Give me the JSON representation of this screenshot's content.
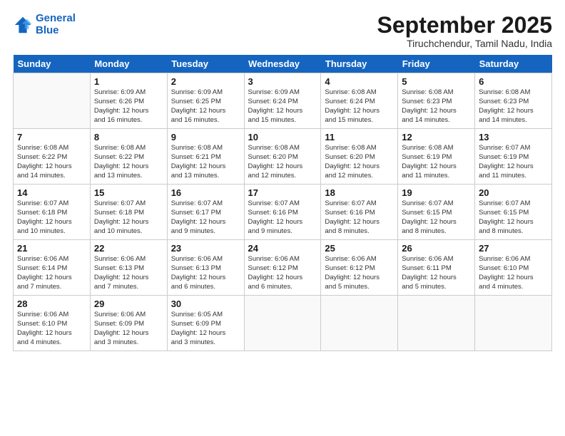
{
  "logo": {
    "line1": "General",
    "line2": "Blue"
  },
  "title": "September 2025",
  "location": "Tiruchchendur, Tamil Nadu, India",
  "days_of_week": [
    "Sunday",
    "Monday",
    "Tuesday",
    "Wednesday",
    "Thursday",
    "Friday",
    "Saturday"
  ],
  "weeks": [
    [
      {
        "num": "",
        "info": ""
      },
      {
        "num": "1",
        "info": "Sunrise: 6:09 AM\nSunset: 6:26 PM\nDaylight: 12 hours\nand 16 minutes."
      },
      {
        "num": "2",
        "info": "Sunrise: 6:09 AM\nSunset: 6:25 PM\nDaylight: 12 hours\nand 16 minutes."
      },
      {
        "num": "3",
        "info": "Sunrise: 6:09 AM\nSunset: 6:24 PM\nDaylight: 12 hours\nand 15 minutes."
      },
      {
        "num": "4",
        "info": "Sunrise: 6:08 AM\nSunset: 6:24 PM\nDaylight: 12 hours\nand 15 minutes."
      },
      {
        "num": "5",
        "info": "Sunrise: 6:08 AM\nSunset: 6:23 PM\nDaylight: 12 hours\nand 14 minutes."
      },
      {
        "num": "6",
        "info": "Sunrise: 6:08 AM\nSunset: 6:23 PM\nDaylight: 12 hours\nand 14 minutes."
      }
    ],
    [
      {
        "num": "7",
        "info": "Sunrise: 6:08 AM\nSunset: 6:22 PM\nDaylight: 12 hours\nand 14 minutes."
      },
      {
        "num": "8",
        "info": "Sunrise: 6:08 AM\nSunset: 6:22 PM\nDaylight: 12 hours\nand 13 minutes."
      },
      {
        "num": "9",
        "info": "Sunrise: 6:08 AM\nSunset: 6:21 PM\nDaylight: 12 hours\nand 13 minutes."
      },
      {
        "num": "10",
        "info": "Sunrise: 6:08 AM\nSunset: 6:20 PM\nDaylight: 12 hours\nand 12 minutes."
      },
      {
        "num": "11",
        "info": "Sunrise: 6:08 AM\nSunset: 6:20 PM\nDaylight: 12 hours\nand 12 minutes."
      },
      {
        "num": "12",
        "info": "Sunrise: 6:08 AM\nSunset: 6:19 PM\nDaylight: 12 hours\nand 11 minutes."
      },
      {
        "num": "13",
        "info": "Sunrise: 6:07 AM\nSunset: 6:19 PM\nDaylight: 12 hours\nand 11 minutes."
      }
    ],
    [
      {
        "num": "14",
        "info": "Sunrise: 6:07 AM\nSunset: 6:18 PM\nDaylight: 12 hours\nand 10 minutes."
      },
      {
        "num": "15",
        "info": "Sunrise: 6:07 AM\nSunset: 6:18 PM\nDaylight: 12 hours\nand 10 minutes."
      },
      {
        "num": "16",
        "info": "Sunrise: 6:07 AM\nSunset: 6:17 PM\nDaylight: 12 hours\nand 9 minutes."
      },
      {
        "num": "17",
        "info": "Sunrise: 6:07 AM\nSunset: 6:16 PM\nDaylight: 12 hours\nand 9 minutes."
      },
      {
        "num": "18",
        "info": "Sunrise: 6:07 AM\nSunset: 6:16 PM\nDaylight: 12 hours\nand 8 minutes."
      },
      {
        "num": "19",
        "info": "Sunrise: 6:07 AM\nSunset: 6:15 PM\nDaylight: 12 hours\nand 8 minutes."
      },
      {
        "num": "20",
        "info": "Sunrise: 6:07 AM\nSunset: 6:15 PM\nDaylight: 12 hours\nand 8 minutes."
      }
    ],
    [
      {
        "num": "21",
        "info": "Sunrise: 6:06 AM\nSunset: 6:14 PM\nDaylight: 12 hours\nand 7 minutes."
      },
      {
        "num": "22",
        "info": "Sunrise: 6:06 AM\nSunset: 6:13 PM\nDaylight: 12 hours\nand 7 minutes."
      },
      {
        "num": "23",
        "info": "Sunrise: 6:06 AM\nSunset: 6:13 PM\nDaylight: 12 hours\nand 6 minutes."
      },
      {
        "num": "24",
        "info": "Sunrise: 6:06 AM\nSunset: 6:12 PM\nDaylight: 12 hours\nand 6 minutes."
      },
      {
        "num": "25",
        "info": "Sunrise: 6:06 AM\nSunset: 6:12 PM\nDaylight: 12 hours\nand 5 minutes."
      },
      {
        "num": "26",
        "info": "Sunrise: 6:06 AM\nSunset: 6:11 PM\nDaylight: 12 hours\nand 5 minutes."
      },
      {
        "num": "27",
        "info": "Sunrise: 6:06 AM\nSunset: 6:10 PM\nDaylight: 12 hours\nand 4 minutes."
      }
    ],
    [
      {
        "num": "28",
        "info": "Sunrise: 6:06 AM\nSunset: 6:10 PM\nDaylight: 12 hours\nand 4 minutes."
      },
      {
        "num": "29",
        "info": "Sunrise: 6:06 AM\nSunset: 6:09 PM\nDaylight: 12 hours\nand 3 minutes."
      },
      {
        "num": "30",
        "info": "Sunrise: 6:05 AM\nSunset: 6:09 PM\nDaylight: 12 hours\nand 3 minutes."
      },
      {
        "num": "",
        "info": ""
      },
      {
        "num": "",
        "info": ""
      },
      {
        "num": "",
        "info": ""
      },
      {
        "num": "",
        "info": ""
      }
    ]
  ]
}
